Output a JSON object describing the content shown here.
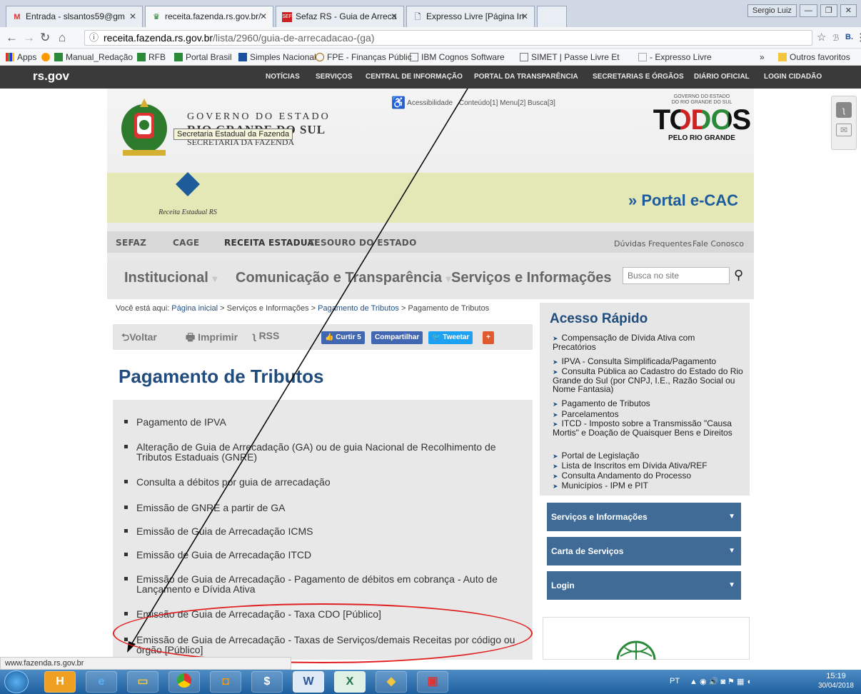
{
  "browser": {
    "tabs": [
      {
        "label": "Entrada - slsantos59@gm",
        "icon": "gmail-icon"
      },
      {
        "label": "receita.fazenda.rs.gov.br/",
        "icon": "rs-crest-icon"
      },
      {
        "label": "Sefaz RS - Guia de Arreca",
        "icon": "sefaz-icon"
      },
      {
        "label": "Expresso Livre [Página In",
        "icon": "page-icon"
      }
    ],
    "user_badge": "Sergio Luiz",
    "url_host": "receita.fazenda.rs.gov.br",
    "url_path": "/lista/2960/guia-de-arrecadacao-(ga)",
    "bookmarks": [
      "Apps",
      "Manual_Redação",
      "RFB",
      "Portal Brasil",
      "Simples Nacional",
      "FPE - Finanças Públic",
      "IBM Cognos Software",
      "SIMET | Passe Livre Et",
      "- Expresso Livre",
      "Outros favoritos"
    ],
    "bookmarks_overflow": "»"
  },
  "site": {
    "logo": "rs.gov",
    "top_links": [
      "NOTÍCIAS",
      "SERVIÇOS",
      "CENTRAL DE INFORMAÇÃO",
      "PORTAL DA TRANSPARÊNCIA",
      "SECRETARIAS E ÓRGÃOS",
      "DIÁRIO OFICIAL",
      "LOGIN CIDADÃO"
    ],
    "gov_line1": "GOVERNO DO ESTADO",
    "gov_line2": "RIO GRANDE DO SUL",
    "gov_line3": "SECRETARIA DA FAZENDA",
    "tooltip": "Secretaria Estadual da Fazenda",
    "accessibility": "Acessibilidade",
    "acc_links": "Conteúdo[1]  Menu[2]  Busca[3]",
    "todos_top": "GOVERNO DO ESTADO\nDO RIO GRANDE DO SUL",
    "todos": "TODOS",
    "todos_sub": "PELO RIO GRANDE",
    "receita_label": "Receita Estadual RS",
    "ecac": "Portal e-CAC",
    "menu1": [
      "SEFAZ",
      "CAGE",
      "RECEITA ESTADUAL",
      "TESOURO DO ESTADO"
    ],
    "menu1_right": [
      "Dúvidas Frequentes",
      "Fale Conosco"
    ],
    "menu2": [
      "Institucional",
      "Comunicação e Transparência",
      "Serviços e Informações"
    ],
    "search_placeholder": "Busca no site"
  },
  "content": {
    "crumb_prefix": "Você está aqui:",
    "crumbs": [
      "Página inicial",
      "Serviços e Informações",
      "Pagamento de Tributos",
      "Pagamento de Tributos"
    ],
    "actions": {
      "back": "Voltar",
      "print": "Imprimir",
      "rss": "RSS",
      "like": "Curtir 5",
      "share": "Compartilhar",
      "tweet": "Tweetar",
      "plus": "+"
    },
    "title": "Pagamento de Tributos",
    "items": [
      "Pagamento de IPVA",
      "Alteração de Guia de Arrecadação (GA) ou de guia Nacional de Recolhimento de Tributos Estaduais (GNRE)",
      "Consulta a débitos por guia de arrecadação",
      "Emissão de GNRE a partir de GA",
      "Emissão de Guia de Arrecadação ICMS",
      "Emissão de Guia de Arrecadação ITCD",
      "Emissão de Guia de Arrecadação - Pagamento de débitos em cobrança - Auto de Lançamento e Dívida Ativa",
      "Emissão de Guia de Arrecadação - Taxa CDO [Público]",
      "Emissão de Guia de Arrecadação - Taxas de Serviços/demais Receitas por código ou órgão [Público]"
    ]
  },
  "sidebar": {
    "title": "Acesso Rápido",
    "links": [
      "Compensação de Dívida Ativa com Precatórios",
      "IPVA - Consulta Simplificada/Pagamento",
      "Consulta Pública ao Cadastro do Estado do Rio Grande do Sul (por CNPJ, I.E., Razão Social ou Nome Fantasia)",
      "Pagamento de Tributos",
      "Parcelamentos",
      "ITCD - Imposto sobre a Transmissão \"Causa Mortis\" e Doação de Quaisquer Bens e Direitos",
      "Portal de Legislação",
      "Lista de Inscritos em Dívida Ativa/REF",
      "Consulta Andamento do Processo",
      "Municípios - IPM e PIT"
    ],
    "boxes": [
      "Serviços e Informações",
      "Carta de Serviços",
      "Login"
    ]
  },
  "status_bar": "www.fazenda.rs.gov.br",
  "taskbar": {
    "lang": "PT",
    "time": "15:19",
    "date": "30/04/2018"
  },
  "colors": {
    "accent": "#1f4c7c",
    "sidebar_box": "#3f6b96",
    "annotation": "#e02020"
  }
}
